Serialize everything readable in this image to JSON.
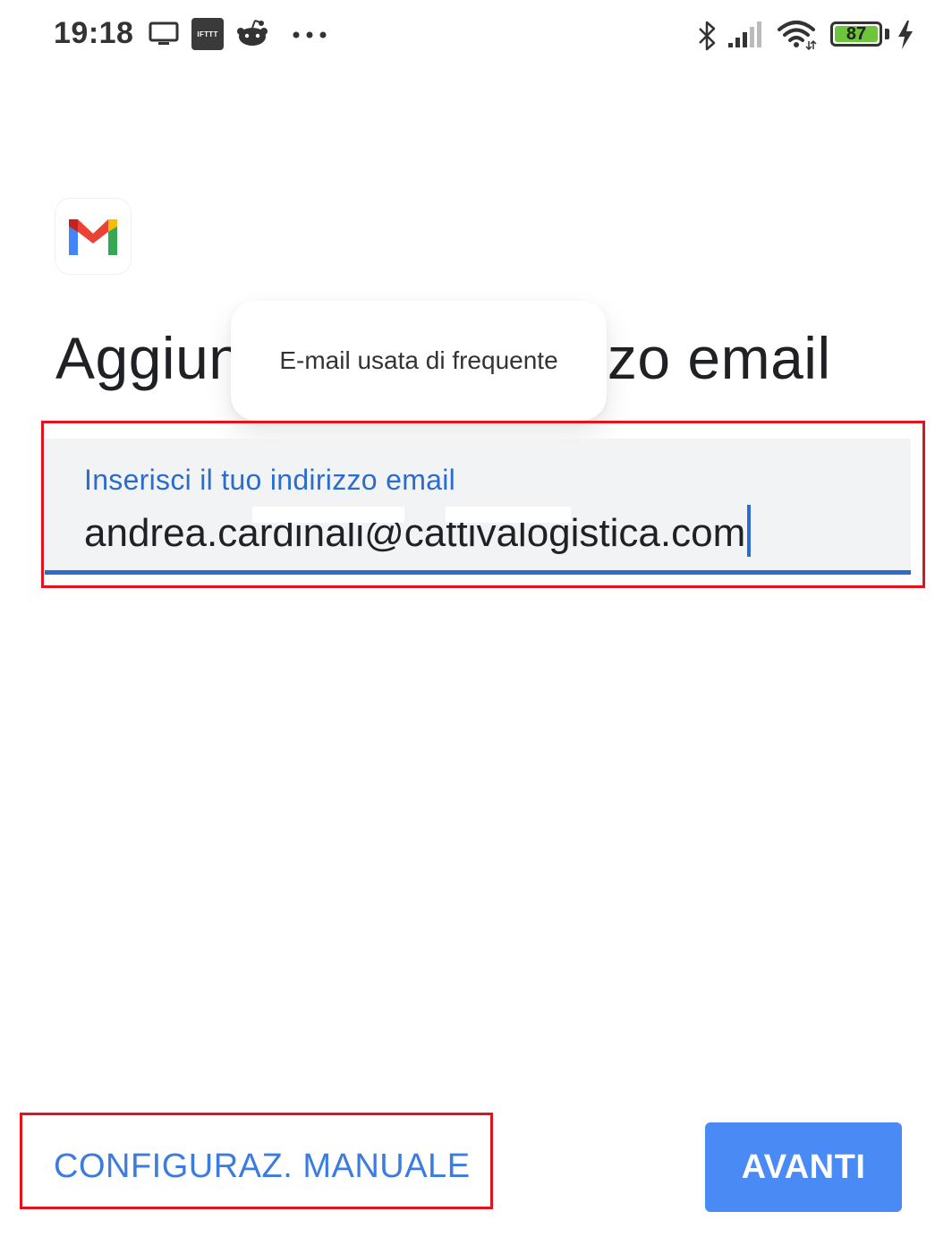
{
  "status_bar": {
    "time": "19:18",
    "ifttt_label": "IFTTT",
    "battery_level": "87",
    "notification_icons": [
      "monitor-icon",
      "ifttt-icon",
      "reddit-icon",
      "more-icon"
    ],
    "system_icons": [
      "bluetooth-icon",
      "signal-icon",
      "wifi-icon",
      "battery-icon",
      "charging-bolt-icon"
    ]
  },
  "app": {
    "logo": "gmail-logo-icon"
  },
  "heading": {
    "text": "Aggiungi il tuo indirizzo email"
  },
  "tooltip": {
    "text": "E-mail usata di frequente"
  },
  "email_field": {
    "label": "Inserisci il tuo indirizzo email",
    "value": "andrea.cardinali@cattivalogistica.com"
  },
  "actions": {
    "manual_setup_label": "CONFIGURAZ. MANUALE",
    "next_label": "AVANTI"
  },
  "colors": {
    "accent_blue": "#2b6ccd",
    "button_blue": "#4a8af4",
    "link_blue": "#3c7be0",
    "highlight_red": "#e2131c",
    "field_bg": "#f1f3f4",
    "battery_green": "#6ec43c"
  }
}
